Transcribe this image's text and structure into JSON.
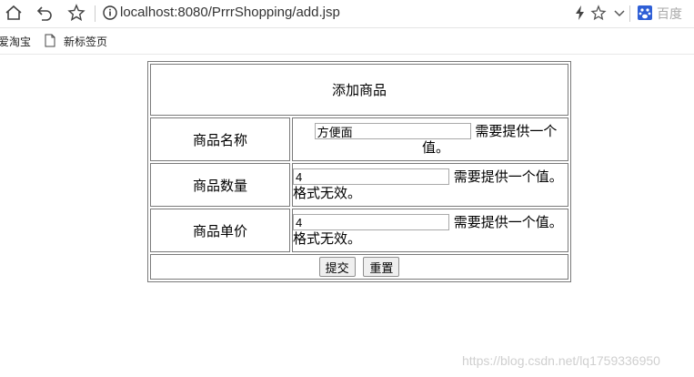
{
  "browser": {
    "url": "localhost:8080/PrrrShopping/add.jsp",
    "search_engine_label": "百度"
  },
  "bookmarks": [
    {
      "label": "爱淘宝"
    },
    {
      "label": "新标签页"
    }
  ],
  "form": {
    "title": "添加商品",
    "rows": [
      {
        "label": "商品名称",
        "value": "方便面",
        "message": "需要提供一个值。"
      },
      {
        "label": "商品数量",
        "value": "4",
        "message": "需要提供一个值。格式无效。"
      },
      {
        "label": "商品单价",
        "value": "4",
        "message": "需要提供一个值。格式无效。"
      }
    ],
    "submit_label": "提交",
    "reset_label": "重置"
  },
  "watermark": "https://blog.csdn.net/lq1759336950",
  "colors": {
    "border": "#7a7a7a",
    "button_bg": "#efefef"
  }
}
